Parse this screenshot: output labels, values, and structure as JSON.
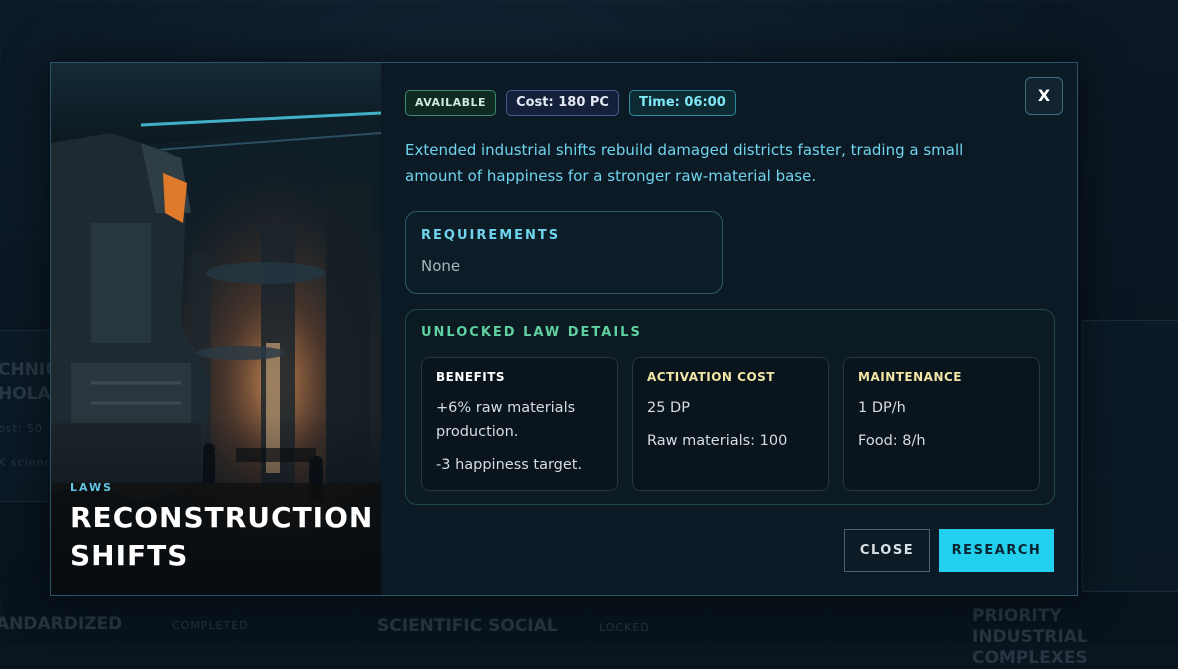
{
  "background": {
    "left_text_1": "CHNIU",
    "left_text_2": "HOLA",
    "left_text_3": "ost: 50",
    "left_text_4": "K scienc",
    "bottom_items": [
      {
        "label": "ANDARDIZED",
        "status": "COMPLETED"
      },
      {
        "label": "SCIENTIFIC SOCIAL",
        "status": "LOCKED"
      },
      {
        "label": "PRIORITY INDUSTRIAL COMPLEXES",
        "status": ""
      }
    ]
  },
  "modal": {
    "category": "LAWS",
    "title": "RECONSTRUCTION SHIFTS",
    "badges": {
      "status": "AVAILABLE",
      "cost": "Cost: 180 PC",
      "time": "Time: 06:00"
    },
    "close_x": "X",
    "description": "Extended industrial shifts rebuild damaged districts faster, trading a small amount of happiness for a stronger raw-material base.",
    "requirements": {
      "heading": "REQUIREMENTS",
      "value": "None"
    },
    "unlocked": {
      "heading": "UNLOCKED LAW DETAILS",
      "cards": [
        {
          "title": "BENEFITS",
          "color": "#ffffff",
          "lines": [
            "+6% raw materials production.",
            "-3 happiness target."
          ]
        },
        {
          "title": "ACTIVATION COST",
          "color": "#f1e6a6",
          "lines": [
            "25 DP",
            "Raw materials: 100"
          ]
        },
        {
          "title": "MAINTENANCE",
          "color": "#f1e6a6",
          "lines": [
            "1 DP/h",
            "Food: 8/h"
          ]
        }
      ]
    },
    "buttons": {
      "close": "CLOSE",
      "research": "RESEARCH"
    }
  },
  "colors": {
    "accent": "#22d0ee",
    "text_cyan": "#6fd4ee",
    "green": "#5fd0a0",
    "panel": "#0c1a25"
  }
}
